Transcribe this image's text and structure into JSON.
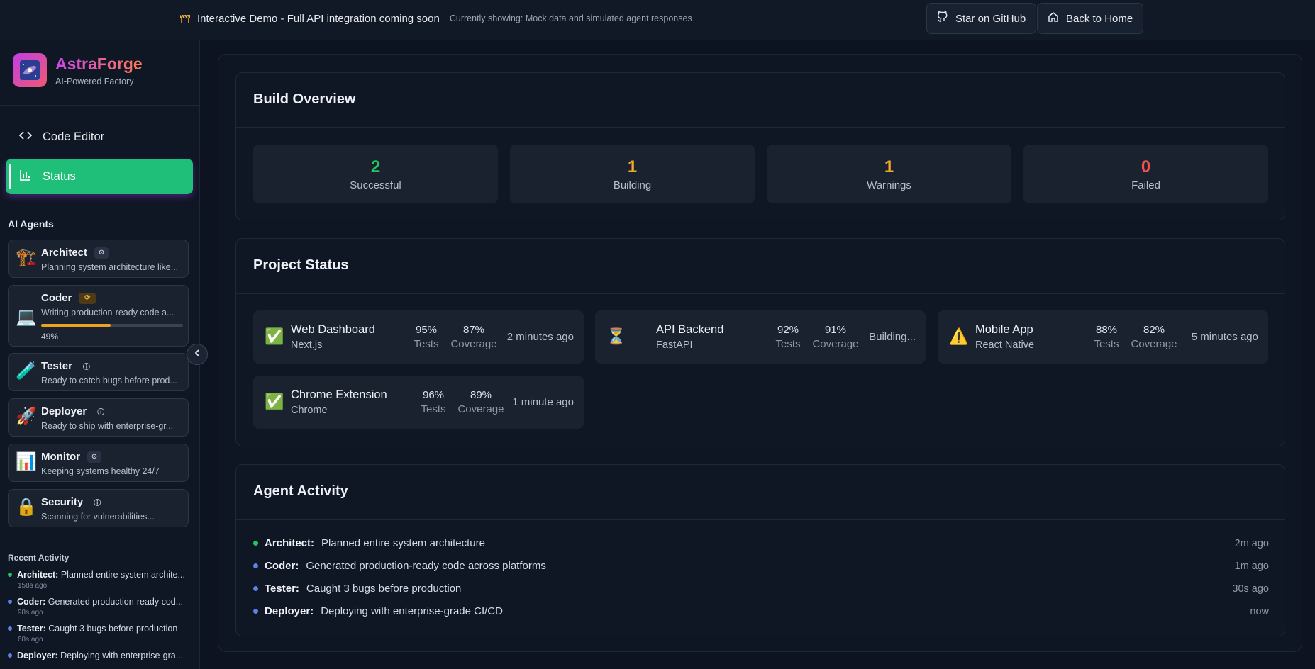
{
  "banner": {
    "message": "Interactive Demo - Full API integration coming soon",
    "sub": "Currently showing: Mock data and simulated agent responses",
    "star_label": "Star on GitHub",
    "home_label": "Back to Home"
  },
  "brand": {
    "name": "AstraForge",
    "tagline": "AI-Powered Factory"
  },
  "nav": {
    "code_editor": "Code Editor",
    "status": "Status"
  },
  "agents_title": "AI Agents",
  "agents": [
    {
      "name": "Architect",
      "desc": "Planning system architecture like...",
      "icon": "🏗️",
      "state": "idle"
    },
    {
      "name": "Coder",
      "desc": "Writing production-ready code a...",
      "icon": "💻",
      "state": "busy",
      "progress": 49,
      "progress_label": "49%"
    },
    {
      "name": "Tester",
      "desc": "Ready to catch bugs before prod...",
      "icon": "🧪",
      "state": "ready"
    },
    {
      "name": "Deployer",
      "desc": "Ready to ship with enterprise-gr...",
      "icon": "🚀",
      "state": "ready"
    },
    {
      "name": "Monitor",
      "desc": "Keeping systems healthy 24/7",
      "icon": "📊",
      "state": "idle"
    },
    {
      "name": "Security",
      "desc": "Scanning for vulnerabilities...",
      "icon": "🔒",
      "state": "ready"
    }
  ],
  "recent": {
    "title": "Recent Activity",
    "items": [
      {
        "agent": "Architect:",
        "text": "Planned entire system archite...",
        "time": "158s ago",
        "color": "#22c55e"
      },
      {
        "agent": "Coder:",
        "text": "Generated production-ready cod...",
        "time": "98s ago",
        "color": "#5b82e6"
      },
      {
        "agent": "Tester:",
        "text": "Caught 3 bugs before production",
        "time": "68s ago",
        "color": "#5b82e6"
      },
      {
        "agent": "Deployer:",
        "text": "Deploying with enterprise-gra...",
        "time": "",
        "color": "#5b82e6"
      }
    ]
  },
  "build": {
    "title": "Build Overview",
    "stats": [
      {
        "value": "2",
        "label": "Successful",
        "color": "#22c55e"
      },
      {
        "value": "1",
        "label": "Building",
        "color": "#f0a92b"
      },
      {
        "value": "1",
        "label": "Warnings",
        "color": "#f0a92b"
      },
      {
        "value": "0",
        "label": "Failed",
        "color": "#ef5350"
      }
    ]
  },
  "projects": {
    "title": "Project Status",
    "tests_label": "Tests",
    "coverage_label": "Coverage",
    "items": [
      {
        "name": "Web Dashboard",
        "framework": "Next.js",
        "icon": "✅",
        "tests": "95%",
        "coverage": "87%",
        "time": "2 minutes ago"
      },
      {
        "name": "API Backend",
        "framework": "FastAPI",
        "icon": "⏳",
        "tests": "92%",
        "coverage": "91%",
        "time": "Building..."
      },
      {
        "name": "Mobile App",
        "framework": "React Native",
        "icon": "⚠️",
        "tests": "88%",
        "coverage": "82%",
        "time": "5 minutes ago"
      },
      {
        "name": "Chrome Extension",
        "framework": "Chrome",
        "icon": "✅",
        "tests": "96%",
        "coverage": "89%",
        "time": "1 minute ago"
      }
    ]
  },
  "activity": {
    "title": "Agent Activity",
    "items": [
      {
        "agent": "Architect:",
        "text": "Planned entire system architecture",
        "time": "2m ago",
        "color": "#22c55e"
      },
      {
        "agent": "Coder:",
        "text": "Generated production-ready code across platforms",
        "time": "1m ago",
        "color": "#5b82e6"
      },
      {
        "agent": "Tester:",
        "text": "Caught 3 bugs before production",
        "time": "30s ago",
        "color": "#5b82e6"
      },
      {
        "agent": "Deployer:",
        "text": "Deploying with enterprise-grade CI/CD",
        "time": "now",
        "color": "#5b82e6"
      }
    ]
  }
}
